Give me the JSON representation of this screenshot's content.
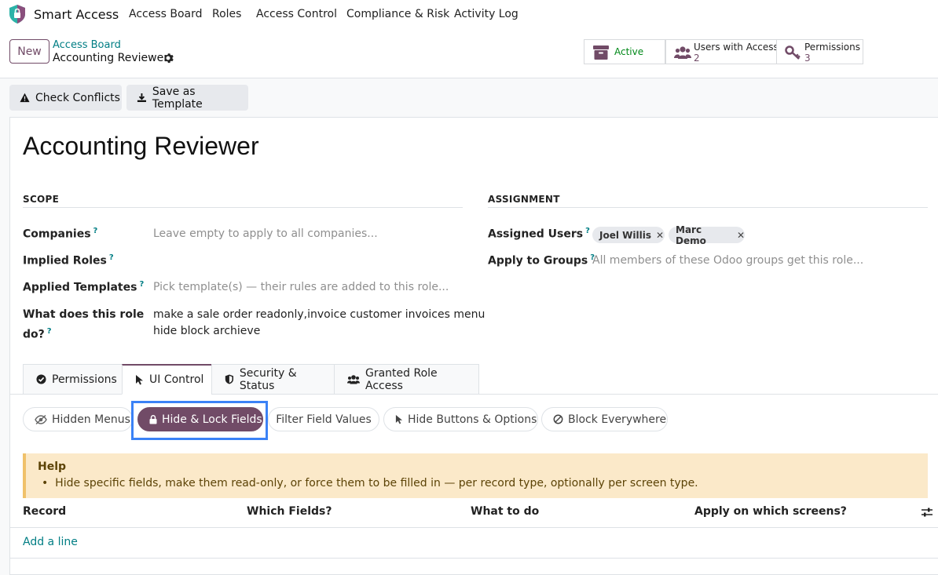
{
  "app": {
    "brand": "Smart Access",
    "nav": [
      "Access Board",
      "Roles",
      "Access Control",
      "Compliance & Risk",
      "Activity Log"
    ]
  },
  "control_panel": {
    "new_label": "New",
    "breadcrumb_parent": "Access Board",
    "breadcrumb_current": "Accounting Reviewer",
    "stats": {
      "active_label": "Active",
      "users_label": "Users with Access",
      "users_count": "2",
      "permissions_label": "Permissions",
      "permissions_count": "3"
    }
  },
  "actions": {
    "check_conflicts": "Check Conflicts",
    "save_template": "Save as Template"
  },
  "record": {
    "title": "Accounting Reviewer",
    "scope": {
      "heading": "SCOPE",
      "companies_label": "Companies",
      "companies_placeholder": "Leave empty to apply to all companies...",
      "implied_roles_label": "Implied Roles",
      "applied_templates_label": "Applied Templates",
      "applied_templates_placeholder": "Pick template(s) — their rules are added to this role...",
      "what_does_label_1": "What does this role",
      "what_does_label_2": "do?",
      "what_does_value_1": "make a sale order readonly,invoice customer invoices menu",
      "what_does_value_2": "hide block archieve"
    },
    "assignment": {
      "heading": "ASSIGNMENT",
      "assigned_users_label": "Assigned Users",
      "users": [
        "Joel Willis",
        "Marc Demo"
      ],
      "apply_groups_label": "Apply to Groups",
      "apply_groups_placeholder": "All members of these Odoo groups get this role..."
    },
    "help_marker": "?"
  },
  "tabs": [
    "Permissions",
    "UI Control",
    "Security & Status",
    "Granted Role Access"
  ],
  "active_tab": "UI Control",
  "subtabs": [
    "Hidden Menus",
    "Hide & Lock Fields",
    "Filter Field Values",
    "Hide Buttons & Options",
    "Block Everywhere"
  ],
  "active_subtab": "Hide & Lock Fields",
  "help": {
    "title": "Help",
    "text": "Hide specific fields, make them read-only, or force them to be filled in — per record type, optionally per screen type."
  },
  "list": {
    "columns": [
      "Record",
      "Which Fields?",
      "What to do",
      "Apply on which screens?"
    ],
    "add_line": "Add a line"
  },
  "colors": {
    "brand": "#714b67",
    "link": "#017e84",
    "active_status": "#008818",
    "help_bg": "#fbe9c9"
  }
}
